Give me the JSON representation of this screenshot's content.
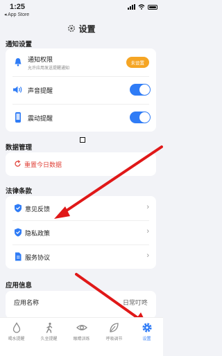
{
  "status": {
    "time": "1:25",
    "back_label": "◂ App Store"
  },
  "nav": {
    "title": "设置"
  },
  "sections": {
    "notify": "通知设置",
    "data": "数据管理",
    "legal": "法律条款",
    "app": "应用信息"
  },
  "notify": {
    "permission_label": "通知权限",
    "permission_sub": "允许应用发送提醒通知",
    "permission_badge": "未设置",
    "sound_label": "声音提醒",
    "vibrate_label": "震动提醒",
    "sound_on": true,
    "vibrate_on": true
  },
  "data": {
    "reset_label": "重置今日数据"
  },
  "legal": {
    "feedback_label": "意见反馈",
    "privacy_label": "隐私政策",
    "terms_label": "服务协议"
  },
  "app": {
    "name_label": "应用名称",
    "name_value": "日常叮咚"
  },
  "tabs": [
    {
      "label": "喝水提醒",
      "icon": "water-drop-icon"
    },
    {
      "label": "久坐提醒",
      "icon": "walking-icon"
    },
    {
      "label": "眼睛训练",
      "icon": "eye-icon"
    },
    {
      "label": "呼吸调节",
      "icon": "leaf-icon"
    },
    {
      "label": "设置",
      "icon": "gear-icon"
    }
  ],
  "colors": {
    "accent": "#2f7cf6",
    "badge": "#f5a524",
    "danger": "#e0433a",
    "annotation": "#e01818"
  }
}
